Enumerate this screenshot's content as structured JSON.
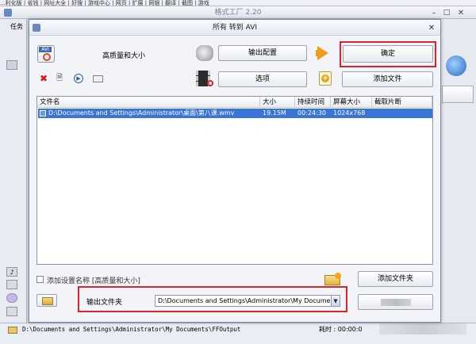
{
  "bg_app": {
    "title": "格式工厂 2.20",
    "menubar_text": "...利化版  | 省钱  | 网址大全  | 好搜  | 游戏中心  | 网页  | 扩展 | 网银 | 翻译 | 截图 | 游戏",
    "left_tab": "任务",
    "status_path": "D:\\Documents and Settings\\Administrator\\My Documents\\FFOutput",
    "status_time_label": "耗时 : 00:00:0"
  },
  "dialog": {
    "title": "所有 转到 AVI",
    "quality_label": "高质量和大小",
    "output_config_button": "输出配置",
    "ok_button": "确定",
    "options_button": "选项",
    "add_file_button": "添加文件",
    "file_table": {
      "columns": [
        "文件名",
        "大小",
        "持续时间",
        "屏幕大小",
        "截取片断"
      ],
      "rows": [
        {
          "name": "D:\\Documents and Settings\\Administrator\\桌面\\第八课.wmv",
          "size": "19.15M",
          "duration": "00:24:30",
          "screen": "1024x768",
          "clip": ""
        }
      ]
    },
    "add_setting_name_label": "添加设置名称 [高质量和大小]",
    "add_folder_button": "添加文件夹",
    "output_folder_label": "输出文件夹",
    "output_folder_value": "D:\\Documents and Settings\\Administrator\\My Documents\\FFO"
  },
  "colors": {
    "accent_selection": "#3875d7",
    "highlight_box": "#d9262c"
  }
}
